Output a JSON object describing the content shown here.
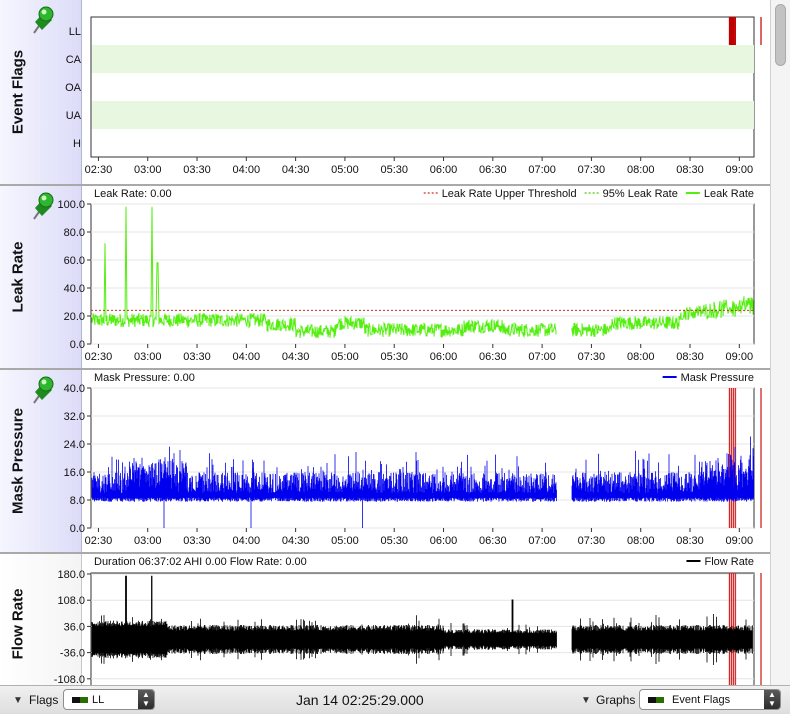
{
  "graphs": [
    {
      "id": "event-flags",
      "title": "Event Flags",
      "header_left": "",
      "legend": [],
      "flags": [
        "LL",
        "CA",
        "OA",
        "UA",
        "H"
      ],
      "flag_band_color": "#e8f8e0",
      "ll_events_hours": [
        8.9,
        8.92,
        8.94,
        8.96,
        9.22
      ],
      "event_color": "#c00000"
    },
    {
      "id": "leak-rate",
      "title": "Leak Rate",
      "header_left": "Leak Rate: 0.00",
      "legend": [
        {
          "name": "Leak Rate Upper Threshold",
          "color": "#cc3322",
          "style": "dashed"
        },
        {
          "name": "95% Leak Rate",
          "color": "#44cc00",
          "style": "dashed"
        },
        {
          "name": "Leak Rate",
          "color": "#55ee11",
          "style": "solid"
        }
      ],
      "y_ticks": [
        "0.0",
        "20.0",
        "40.0",
        "60.0",
        "80.0",
        "100.0"
      ],
      "ylim": [
        0,
        100
      ],
      "threshold": 24,
      "series_color": "#55ee11"
    },
    {
      "id": "mask-pressure",
      "title": "Mask Pressure",
      "header_left": "Mask Pressure: 0.00",
      "legend": [
        {
          "name": "Mask Pressure",
          "color": "#0000ee",
          "style": "solid"
        }
      ],
      "y_ticks": [
        "0.0",
        "8.0",
        "16.0",
        "24.0",
        "32.0",
        "40.0"
      ],
      "ylim": [
        0,
        40
      ],
      "series_color": "#0000ee"
    },
    {
      "id": "flow-rate",
      "title": "Flow Rate",
      "header_left": "Duration 06:37:02 AHI 0.00 Flow Rate: 0.00",
      "legend": [
        {
          "name": "Flow Rate",
          "color": "#000000",
          "style": "solid"
        }
      ],
      "y_ticks": [
        "180.0",
        "108.0",
        "36.0",
        "-36.0",
        "-108.0"
      ],
      "ylim": [
        -180,
        180
      ],
      "series_color": "#000000"
    }
  ],
  "x_axis": {
    "start_hour": 2.4247,
    "end_hour": 9.1489,
    "ticks": [
      "02:30",
      "03:00",
      "03:30",
      "04:00",
      "04:30",
      "05:00",
      "05:30",
      "06:00",
      "06:30",
      "07:00",
      "07:30",
      "08:00",
      "08:30",
      "09:00"
    ],
    "tick_hours": [
      2.5,
      3.0,
      3.5,
      4.0,
      4.5,
      5.0,
      5.5,
      6.0,
      6.5,
      7.0,
      7.5,
      8.0,
      8.5,
      9.0
    ],
    "data_gap_hours": [
      7.15,
      7.3
    ]
  },
  "bottom": {
    "flags_label": "Flags",
    "flags_value": "LL",
    "flags_swatch": "#2a6e00",
    "datetime": "Jan 14 02:25:29.000",
    "graphs_label": "Graphs",
    "graphs_value": "Event Flags",
    "graphs_swatch": "#2a6e00"
  }
}
